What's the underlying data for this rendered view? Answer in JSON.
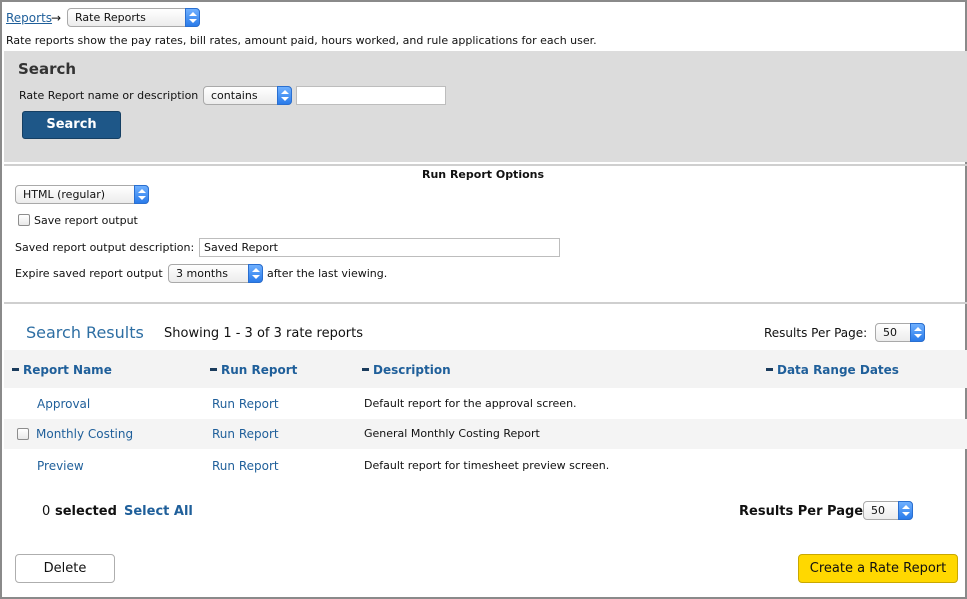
{
  "breadcrumb": {
    "link": "Reports",
    "arrow": "→",
    "current_select": "Rate Reports"
  },
  "intro_text": "Rate reports show the pay rates, bill rates, amount paid, hours worked, and rule applications for each user.",
  "search": {
    "title": "Search",
    "field_label": "Rate Report name or description",
    "operator_value": "contains",
    "query_value": "",
    "button_label": "Search"
  },
  "run_options": {
    "title": "Run Report Options",
    "format_value": "HTML (regular)",
    "save_output_label": "Save report output",
    "save_output_checked": false,
    "description_label": "Saved report output description:",
    "description_value": "Saved Report",
    "expire_label": "Expire saved report output",
    "expire_value": "3 months",
    "expire_suffix": "after the last viewing."
  },
  "results": {
    "title": "Search Results",
    "showing_text": "Showing 1 - 3 of 3 rate reports",
    "per_page_label": "Results Per Page:",
    "per_page_value": "50",
    "columns": [
      "Report Name",
      "Run Report",
      "Description",
      "Data Range Dates"
    ],
    "rows": [
      {
        "name": "Approval",
        "run": "Run Report",
        "description": "Default report for the approval screen.",
        "checkbox": false,
        "dates": ""
      },
      {
        "name": "Monthly Costing",
        "run": "Run Report",
        "description": "General Monthly Costing Report",
        "checkbox": true,
        "dates": ""
      },
      {
        "name": "Preview",
        "run": "Run Report",
        "description": "Default report for timesheet preview screen.",
        "checkbox": false,
        "dates": ""
      }
    ]
  },
  "footer": {
    "selected_count": "0",
    "selected_label": "selected",
    "select_all": "Select All",
    "per_page_label": "Results Per Page:",
    "per_page_value": "50",
    "delete_label": "Delete",
    "create_label": "Create a Rate Report"
  },
  "colors": {
    "link": "#1f5f9a",
    "search_button": "#1e5788",
    "create_button": "#ffd800",
    "panel_bg": "#dcdcdc"
  }
}
